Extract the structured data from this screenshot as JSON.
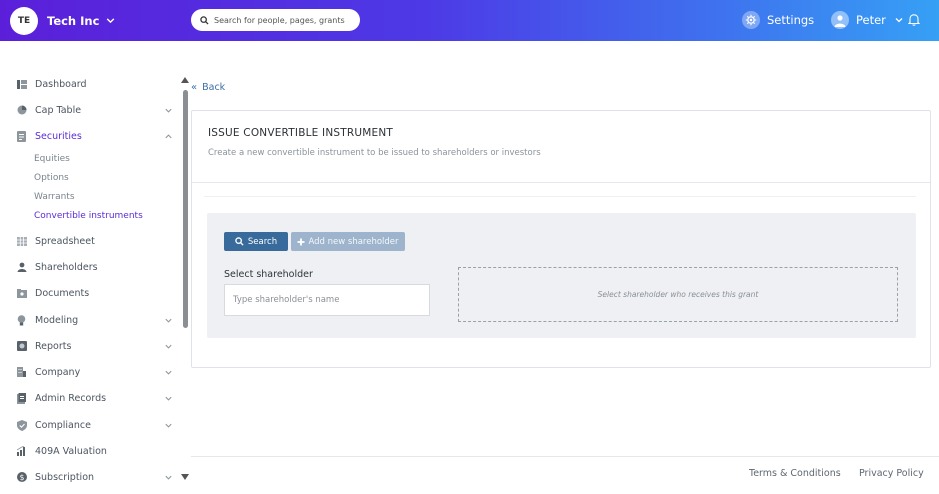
{
  "header": {
    "company_initials": "TE",
    "company_name": "Tech Inc",
    "search_placeholder": "Search for people, pages, grants",
    "settings_label": "Settings",
    "user_name": "Peter",
    "gradient_colors": [
      "#5b1fd9",
      "#36a0f5"
    ]
  },
  "sidebar": {
    "items": [
      {
        "label": "Dashboard",
        "icon": "dashboard-icon"
      },
      {
        "label": "Cap Table",
        "icon": "pie-chart-icon"
      },
      {
        "label": "Securities",
        "icon": "document-icon"
      },
      {
        "label": "Spreadsheet",
        "icon": "grid-icon"
      },
      {
        "label": "Shareholders",
        "icon": "person-icon"
      },
      {
        "label": "Documents",
        "icon": "folder-icon"
      },
      {
        "label": "Modeling",
        "icon": "bulb-icon"
      },
      {
        "label": "Reports",
        "icon": "reports-icon"
      },
      {
        "label": "Company",
        "icon": "building-icon"
      },
      {
        "label": "Admin Records",
        "icon": "records-icon"
      },
      {
        "label": "Compliance",
        "icon": "shield-icon"
      },
      {
        "label": "409A Valuation",
        "icon": "chart-icon"
      },
      {
        "label": "Subscription",
        "icon": "dollar-icon"
      }
    ],
    "securities_sub": [
      "Equities",
      "Options",
      "Warrants",
      "Convertible instruments"
    ],
    "active_color": "#5a2bd8"
  },
  "main": {
    "back_label": "Back",
    "card_title": "ISSUE CONVERTIBLE INSTRUMENT",
    "card_subtitle": "Create a new convertible instrument to be issued to shareholders or investors",
    "search_button": "Search",
    "add_button": "Add new shareholder",
    "select_label": "Select shareholder",
    "shareholder_placeholder": "Type shareholder's name",
    "dropzone_text": "Select shareholder who receives this grant"
  },
  "footer": {
    "terms": "Terms & Conditions",
    "privacy": "Privacy Policy"
  }
}
